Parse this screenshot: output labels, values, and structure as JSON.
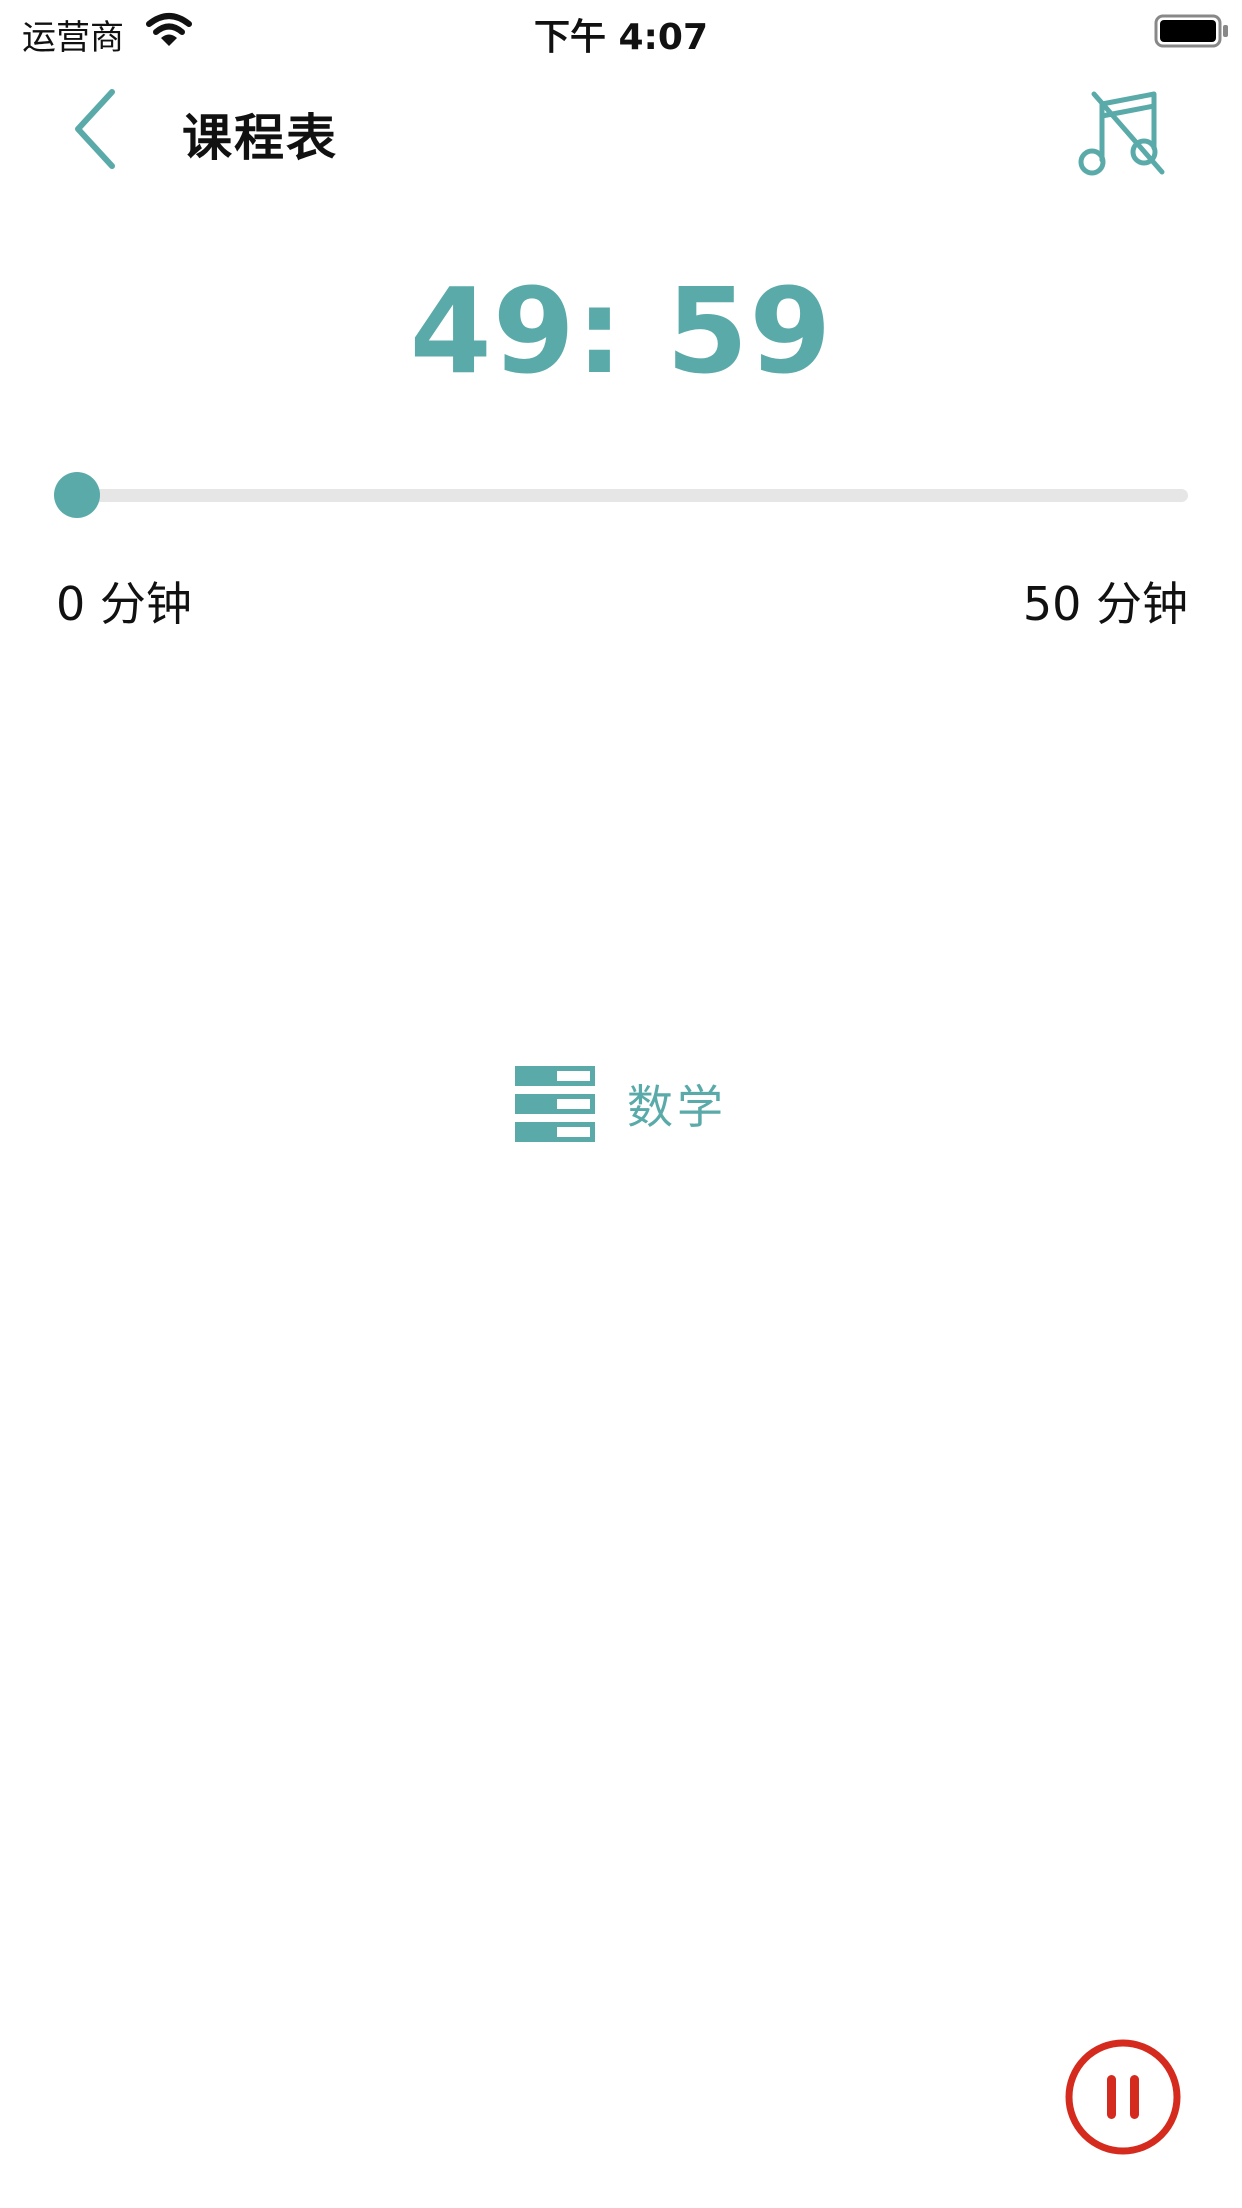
{
  "status_bar": {
    "carrier": "运营商",
    "time": "下午 4:07",
    "icons": [
      "wifi-icon",
      "battery-icon"
    ]
  },
  "nav": {
    "title": "课程表",
    "back_icon": "chevron-left-icon",
    "right_icon": "music-off-icon"
  },
  "timer": {
    "display": "49: 59"
  },
  "slider": {
    "progress": 0,
    "min_label": "0 分钟",
    "max_label": "50 分钟"
  },
  "subject": {
    "icon": "list-icon",
    "label": "数学"
  },
  "controls": {
    "pause_icon": "pause-icon"
  },
  "colors": {
    "accent": "#5aaaaa",
    "pause": "#d42b1e",
    "track": "#e6e6e6"
  }
}
